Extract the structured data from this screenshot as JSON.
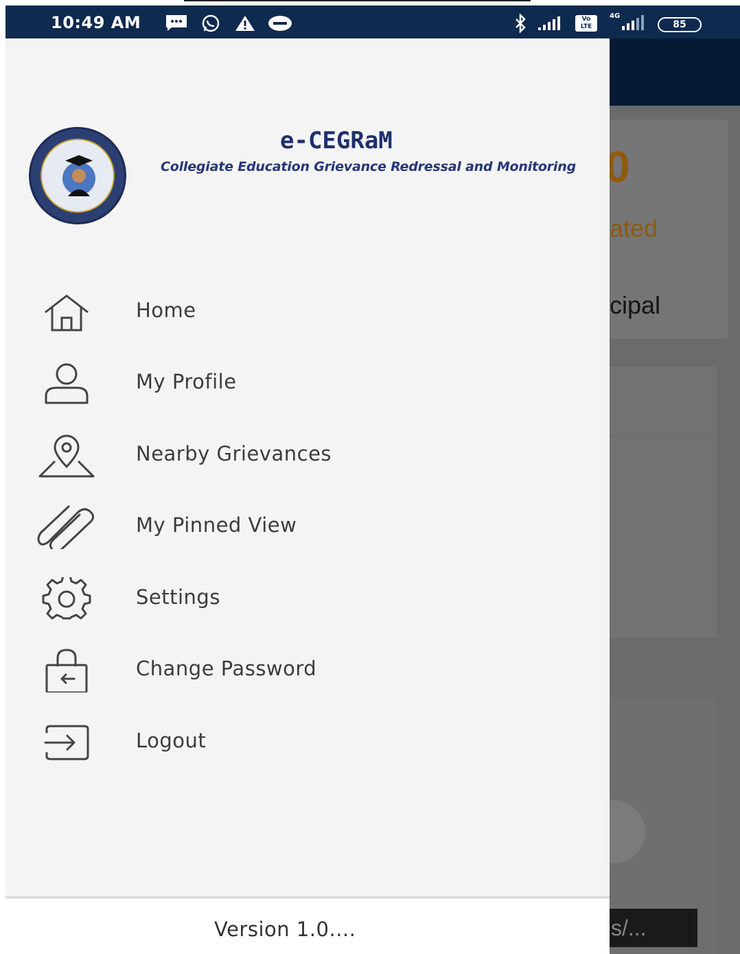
{
  "status_bar": {
    "time": "10:49 AM",
    "battery": "85",
    "network_label": "4G",
    "volte_label": "Vo LTE"
  },
  "background_app": {
    "visible_fragments": [
      "0",
      "ated",
      "cipal",
      "s/..."
    ],
    "accent_color": "#e08a00"
  },
  "drawer": {
    "brand": {
      "title": "e-CEGRaM",
      "subtitle": "Collegiate Education Grievance Redressal and Monitoring"
    },
    "menu": [
      {
        "label": "Home",
        "icon": "home-icon"
      },
      {
        "label": "My Profile",
        "icon": "user-icon"
      },
      {
        "label": "Nearby Grievances",
        "icon": "map-pin-icon"
      },
      {
        "label": "My Pinned View",
        "icon": "paperclip-icon"
      },
      {
        "label": "Settings",
        "icon": "gear-icon"
      },
      {
        "label": "Change Password",
        "icon": "lock-icon"
      },
      {
        "label": "Logout",
        "icon": "logout-icon"
      }
    ],
    "footer": {
      "version": "Version 1.0...."
    }
  },
  "colors": {
    "status_bar_bg": "#0f2a4f",
    "drawer_bg": "#f4f4f4",
    "brand_text": "#1f2f6e"
  }
}
